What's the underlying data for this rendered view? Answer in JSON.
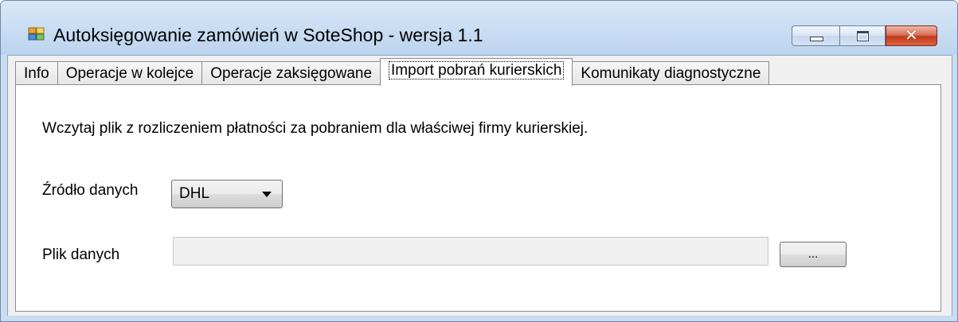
{
  "window": {
    "title": "Autoksięgowanie zamówień w SoteShop - wersja 1.1",
    "icon": "app-window-icon",
    "caption_buttons": {
      "minimize": "minimize-icon",
      "maximize": "maximize-icon",
      "close": "✕"
    }
  },
  "tabs": [
    {
      "label": "Info"
    },
    {
      "label": "Operacje w kolejce"
    },
    {
      "label": "Operacje zaksięgowane"
    },
    {
      "label": "Import pobrań kurierskich"
    },
    {
      "label": "Komunikaty diagnostyczne"
    }
  ],
  "active_tab": "Import pobrań kurierskich",
  "panel": {
    "instruction": "Wczytaj plik z rozliczeniem płatności za pobraniem dla właściwej firmy kurierskiej.",
    "source_label": "Źródło danych",
    "source_value": "DHL",
    "file_label": "Plik danych",
    "file_value": "",
    "browse_label": "..."
  },
  "colors": {
    "titlebar": "#c7dcf2",
    "close_button": "#c23a1c",
    "panel_background": "#ffffff"
  }
}
